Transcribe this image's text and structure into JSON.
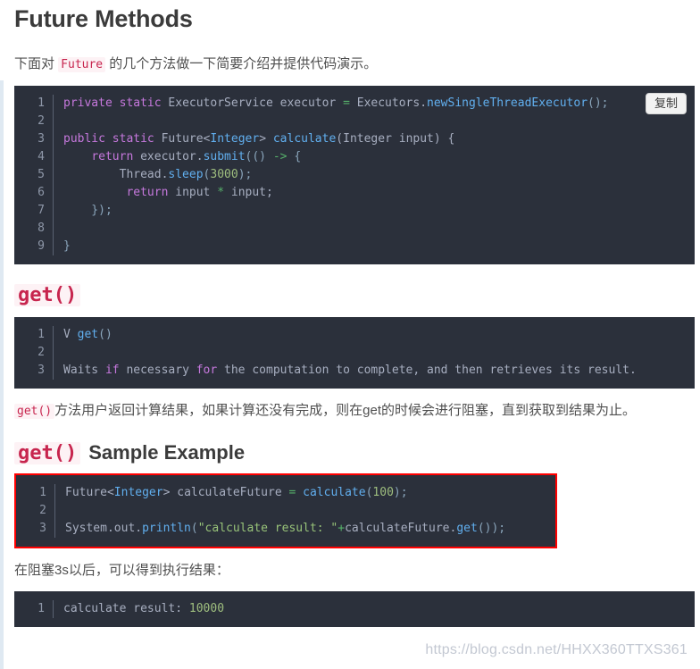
{
  "page": {
    "title": "Future Methods",
    "intro_prefix": "下面对 ",
    "intro_code": "Future",
    "intro_suffix": " 的几个方法做一下简要介绍并提供代码演示。"
  },
  "copy_button": {
    "label": "复制"
  },
  "code_block_1": {
    "lines": [
      {
        "n": "1",
        "tokens": [
          {
            "t": "private",
            "c": "kw"
          },
          {
            "t": " ",
            "c": "plain"
          },
          {
            "t": "static",
            "c": "kw"
          },
          {
            "t": " ",
            "c": "plain"
          },
          {
            "t": "ExecutorService executor ",
            "c": "plain"
          },
          {
            "t": "=",
            "c": "eq"
          },
          {
            "t": " Executors.",
            "c": "plain"
          },
          {
            "t": "newSingleThreadExecutor",
            "c": "fn"
          },
          {
            "t": "();",
            "c": "op"
          }
        ]
      },
      {
        "n": "2",
        "tokens": []
      },
      {
        "n": "3",
        "tokens": [
          {
            "t": "public",
            "c": "kw"
          },
          {
            "t": " ",
            "c": "plain"
          },
          {
            "t": "static",
            "c": "kw"
          },
          {
            "t": " Future<",
            "c": "plain"
          },
          {
            "t": "Integer",
            "c": "cls"
          },
          {
            "t": "> ",
            "c": "plain"
          },
          {
            "t": "calculate",
            "c": "fn"
          },
          {
            "t": "(Integer input) {",
            "c": "plain"
          }
        ]
      },
      {
        "n": "4",
        "tokens": [
          {
            "t": "    ",
            "c": "plain"
          },
          {
            "t": "return",
            "c": "kw"
          },
          {
            "t": " executor.",
            "c": "plain"
          },
          {
            "t": "submit",
            "c": "fn"
          },
          {
            "t": "(() ",
            "c": "op"
          },
          {
            "t": "->",
            "c": "arrow"
          },
          {
            "t": " {",
            "c": "op"
          }
        ]
      },
      {
        "n": "5",
        "tokens": [
          {
            "t": "        Thread.",
            "c": "plain"
          },
          {
            "t": "sleep",
            "c": "fn"
          },
          {
            "t": "(",
            "c": "op"
          },
          {
            "t": "3000",
            "c": "num"
          },
          {
            "t": ");",
            "c": "op"
          }
        ]
      },
      {
        "n": "6",
        "tokens": [
          {
            "t": "         ",
            "c": "plain"
          },
          {
            "t": "return",
            "c": "kw"
          },
          {
            "t": " input ",
            "c": "plain"
          },
          {
            "t": "*",
            "c": "arrow"
          },
          {
            "t": " input;",
            "c": "plain"
          }
        ]
      },
      {
        "n": "7",
        "tokens": [
          {
            "t": "    });",
            "c": "op"
          }
        ]
      },
      {
        "n": "8",
        "tokens": []
      },
      {
        "n": "9",
        "tokens": [
          {
            "t": "}",
            "c": "op"
          }
        ]
      }
    ]
  },
  "section_get": {
    "heading_code": "get()",
    "heading_rest": ""
  },
  "code_block_2": {
    "lines": [
      {
        "n": "1",
        "tokens": [
          {
            "t": "V ",
            "c": "plain"
          },
          {
            "t": "get",
            "c": "fn"
          },
          {
            "t": "()",
            "c": "op"
          }
        ]
      },
      {
        "n": "2",
        "tokens": []
      },
      {
        "n": "3",
        "tokens": [
          {
            "t": "Waits ",
            "c": "plain"
          },
          {
            "t": "if",
            "c": "kw"
          },
          {
            "t": " necessary ",
            "c": "plain"
          },
          {
            "t": "for",
            "c": "kw"
          },
          {
            "t": " the computation to complete, and then retrieves its result.",
            "c": "plain"
          }
        ]
      }
    ]
  },
  "paragraph_get": {
    "code": "get()",
    "text": "方法用户返回计算结果，如果计算还没有完成，则在get的时候会进行阻塞，直到获取到结果为止。"
  },
  "section_sample": {
    "heading_code": "get()",
    "heading_rest": "Sample Example"
  },
  "code_block_3": {
    "lines": [
      {
        "n": "1",
        "tokens": [
          {
            "t": "Future<",
            "c": "plain"
          },
          {
            "t": "Integer",
            "c": "cls"
          },
          {
            "t": "> calculateFuture ",
            "c": "plain"
          },
          {
            "t": "=",
            "c": "eq"
          },
          {
            "t": " ",
            "c": "plain"
          },
          {
            "t": "calculate",
            "c": "fn"
          },
          {
            "t": "(",
            "c": "op"
          },
          {
            "t": "100",
            "c": "num"
          },
          {
            "t": ");",
            "c": "op"
          }
        ]
      },
      {
        "n": "2",
        "tokens": []
      },
      {
        "n": "3",
        "tokens": [
          {
            "t": "System.out.",
            "c": "plain"
          },
          {
            "t": "println",
            "c": "fn"
          },
          {
            "t": "(",
            "c": "op"
          },
          {
            "t": "\"calculate result: \"",
            "c": "str"
          },
          {
            "t": "+",
            "c": "arrow"
          },
          {
            "t": "calculateFuture.",
            "c": "plain"
          },
          {
            "t": "get",
            "c": "fn"
          },
          {
            "t": "());",
            "c": "op"
          }
        ]
      }
    ]
  },
  "paragraph_result": {
    "text": "在阻塞3s以后，可以得到执行结果："
  },
  "code_block_4": {
    "lines": [
      {
        "n": "1",
        "tokens": [
          {
            "t": "calculate result: ",
            "c": "plain"
          },
          {
            "t": "10000",
            "c": "num"
          }
        ]
      }
    ]
  },
  "watermark": {
    "text": "https://blog.csdn.net/HHXX360TTXS361"
  },
  "colors": {
    "code_bg": "#2b303b",
    "keyword": "#c678dd",
    "class": "#61afef",
    "string": "#98c379",
    "number": "#9fbf7f",
    "inline_code_text": "#c7254e",
    "inline_code_bg": "#fdf2f5",
    "highlight_border": "#ff0000"
  }
}
